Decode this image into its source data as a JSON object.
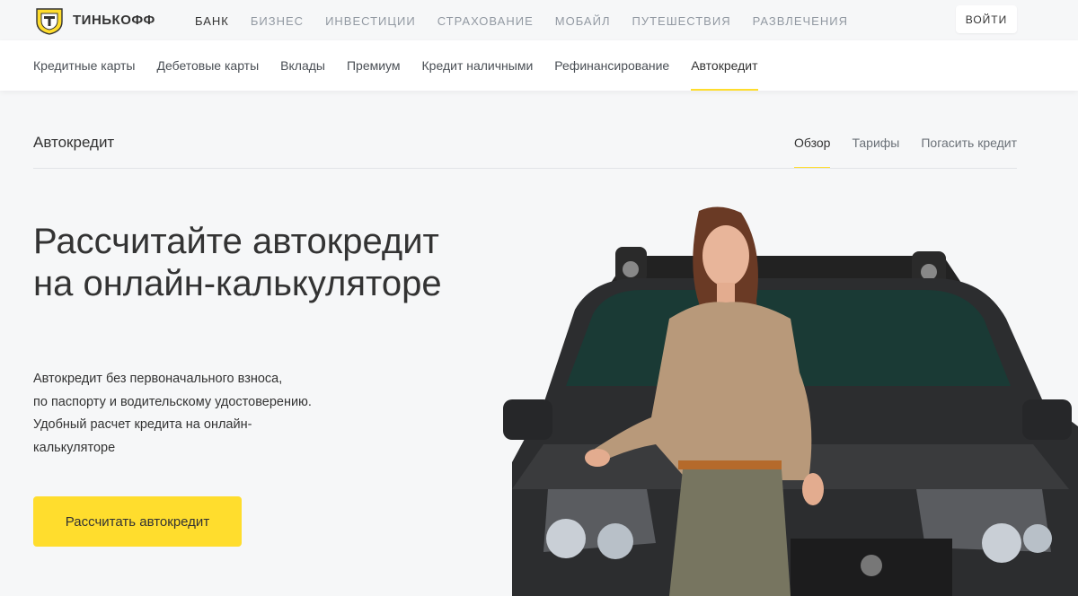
{
  "brand": {
    "name": "ТИНЬКОФФ",
    "logo_icon": "tinkoff-emblem-icon"
  },
  "topnav": [
    {
      "label": "БАНК",
      "active": true
    },
    {
      "label": "БИЗНЕС"
    },
    {
      "label": "ИНВЕСТИЦИИ"
    },
    {
      "label": "СТРАХОВАНИЕ"
    },
    {
      "label": "МОБАЙЛ"
    },
    {
      "label": "ПУТЕШЕСТВИЯ"
    },
    {
      "label": "РАЗВЛЕЧЕНИЯ"
    }
  ],
  "login_label": "ВОЙТИ",
  "subnav": [
    {
      "label": "Кредитные карты"
    },
    {
      "label": "Дебетовые карты"
    },
    {
      "label": "Вклады"
    },
    {
      "label": "Премиум"
    },
    {
      "label": "Кредит наличными"
    },
    {
      "label": "Рефинансирование"
    },
    {
      "label": "Автокредит",
      "active": true
    }
  ],
  "section": {
    "title": "Автокредит",
    "tabs": [
      {
        "label": "Обзор",
        "active": true
      },
      {
        "label": "Тарифы"
      },
      {
        "label": "Погасить кредит"
      }
    ]
  },
  "hero": {
    "title": "Рассчитайте автокредит на онлайн-калькуляторе",
    "description_lines": [
      "Автокредит без первоначального взноса,",
      "по паспорту и водительскому удостоверению.",
      "Удобный расчет кредита на онлайн-",
      "калькуляторе"
    ],
    "cta_label": "Рассчитать автокредит"
  },
  "colors": {
    "accent": "#ffdd2d",
    "text": "#333333",
    "muted": "#9299a2",
    "background": "#f6f7f8"
  }
}
